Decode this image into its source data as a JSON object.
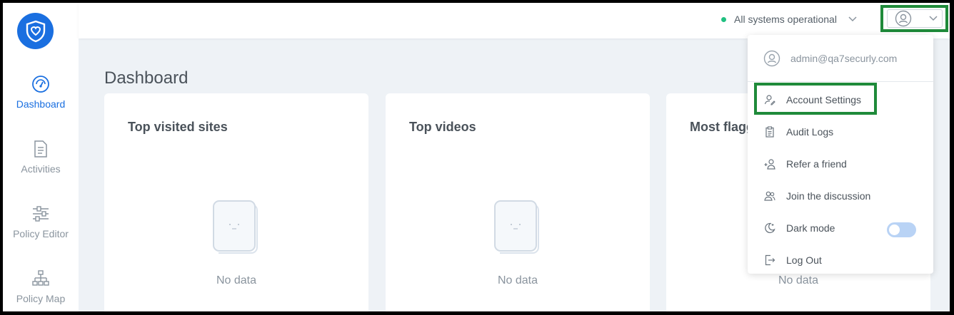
{
  "sidebar": {
    "items": [
      {
        "label": "Dashboard",
        "icon": "dashboard-gauge-icon",
        "active": true
      },
      {
        "label": "Activities",
        "icon": "document-icon"
      },
      {
        "label": "Policy Editor",
        "icon": "sliders-icon"
      },
      {
        "label": "Policy Map",
        "icon": "sitemap-icon"
      }
    ]
  },
  "topbar": {
    "status_text": "All systems operational",
    "status_color": "#20c080"
  },
  "page": {
    "title": "Dashboard"
  },
  "cards": [
    {
      "title": "Top visited sites",
      "empty_text": "No data"
    },
    {
      "title": "Top videos",
      "empty_text": "No data"
    },
    {
      "title": "Most flagg",
      "empty_text": "No data"
    }
  ],
  "menu": {
    "email": "admin@qa7securly.com",
    "items": [
      {
        "label": "Account Settings",
        "icon": "user-edit-icon"
      },
      {
        "label": "Audit Logs",
        "icon": "clipboard-icon"
      },
      {
        "label": "Refer a friend",
        "icon": "user-add-icon"
      },
      {
        "label": "Join the discussion",
        "icon": "users-icon"
      },
      {
        "label": "Dark mode",
        "icon": "moon-icon",
        "toggle_on": false
      },
      {
        "label": "Log Out",
        "icon": "logout-icon"
      }
    ]
  },
  "colors": {
    "brand": "#1a6fe0",
    "highlight": "#1f8a3a"
  }
}
